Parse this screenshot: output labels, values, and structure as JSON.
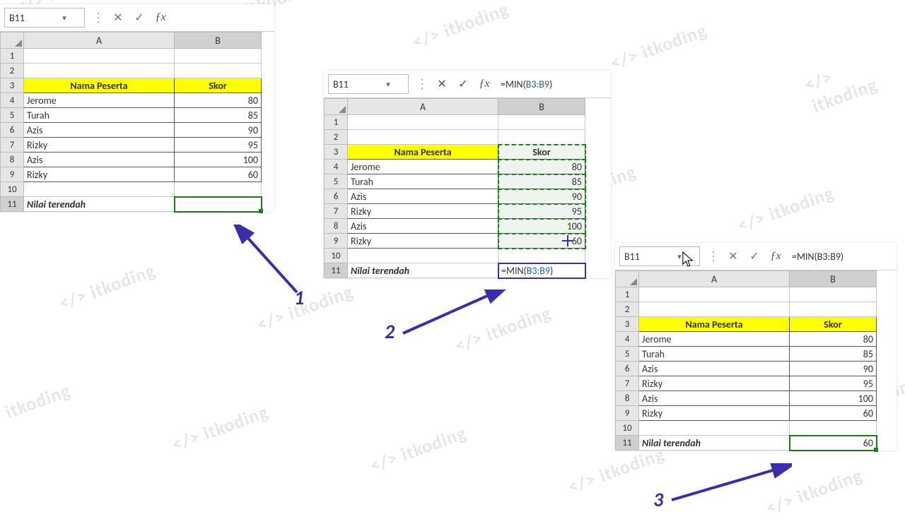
{
  "chart_data": {
    "type": "table",
    "columns": [
      "Nama Peserta",
      "Skor"
    ],
    "rows": [
      [
        "Jerome",
        80
      ],
      [
        "Turah",
        85
      ],
      [
        "Azis",
        90
      ],
      [
        "Rizky",
        95
      ],
      [
        "Azis",
        100
      ],
      [
        "Rizky",
        60
      ]
    ],
    "result_label": "Nilai terendah",
    "result_formula": "=MIN(B3:B9)",
    "result_value": 60
  },
  "common": {
    "colA_header": "A",
    "colB_header": "B",
    "hdr_name": "Nama Peserta",
    "hdr_score": "Skor",
    "p1": "Jerome",
    "s1": "80",
    "p2": "Turah",
    "s2": "85",
    "p3": "Azis",
    "s3": "90",
    "p4": "Rizky",
    "s4": "95",
    "p5": "Azis",
    "s5": "100",
    "p6": "Rizky",
    "s6": "60",
    "result_label": "Nilai terendah",
    "active_cell": "B11"
  },
  "panel2": {
    "formula_pre": "=MIN(",
    "formula_ref": "B3:B9",
    "formula_post": ")"
  },
  "panel3": {
    "formula": "=MIN(B3:B9)",
    "result": "60",
    "s6": "60"
  },
  "annot": {
    "n1": "1",
    "n2": "2",
    "n3": "3"
  }
}
